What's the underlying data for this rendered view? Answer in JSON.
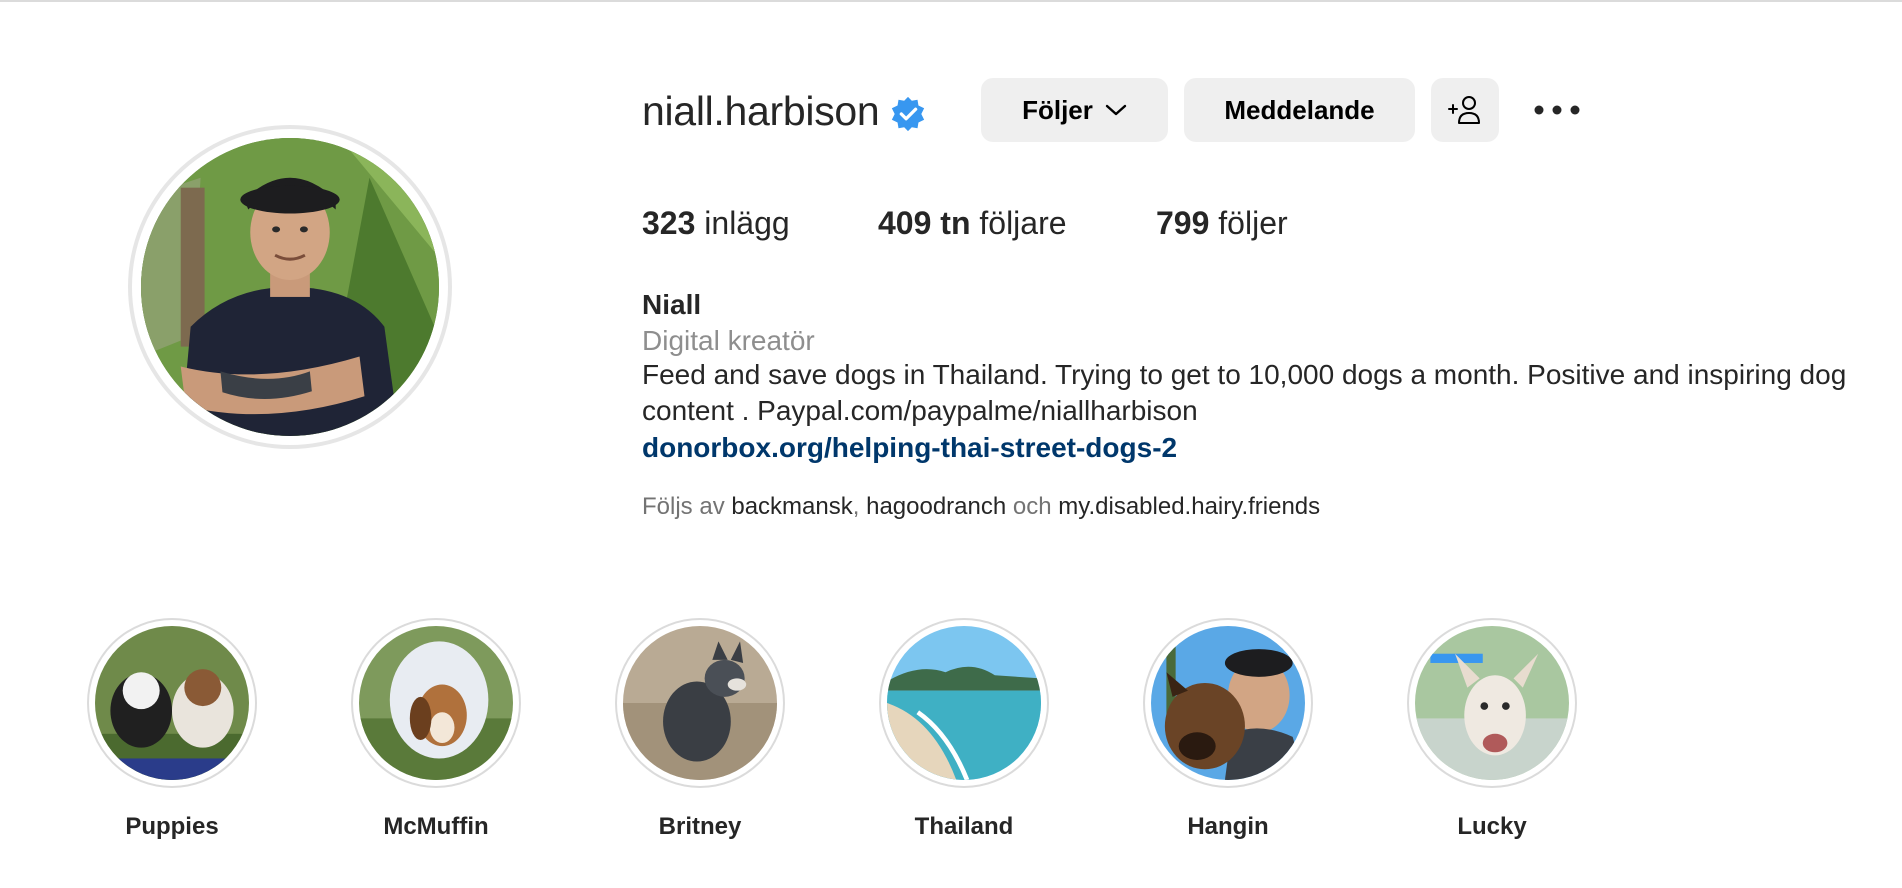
{
  "profile": {
    "username": "niall.harbison",
    "verified": true,
    "buttons": {
      "follow_label": "Följer",
      "message_label": "Meddelande",
      "add_user_icon": "add-user-icon",
      "more_icon": "more-icon"
    },
    "stats": {
      "posts_count": "323",
      "posts_label": "inlägg",
      "followers_count": "409 tn",
      "followers_label": "följare",
      "following_count": "799",
      "following_label": "följer"
    },
    "bio": {
      "name": "Niall",
      "category": "Digital kreatör",
      "text": "Feed and save dogs in Thailand. Trying to get to 10,000 dogs a month. Positive and inspiring dog content . Paypal.com/paypalme/niallharbison",
      "link": "donorbox.org/helping-thai-street-dogs-2"
    },
    "followed_by": {
      "prefix": "Följs av",
      "accounts": [
        "backmansk",
        "hagoodranch",
        "my.disabled.hairy.friends"
      ],
      "separator": ",",
      "conjunction": "och"
    }
  },
  "highlights": [
    {
      "label": "Puppies"
    },
    {
      "label": "McMuffin"
    },
    {
      "label": "Britney"
    },
    {
      "label": "Thailand"
    },
    {
      "label": "Hangin"
    },
    {
      "label": "Lucky"
    }
  ],
  "colors": {
    "verified": "#3897f0",
    "button_bg": "#efefef",
    "link": "#00376b",
    "muted": "#8e8e8e"
  }
}
